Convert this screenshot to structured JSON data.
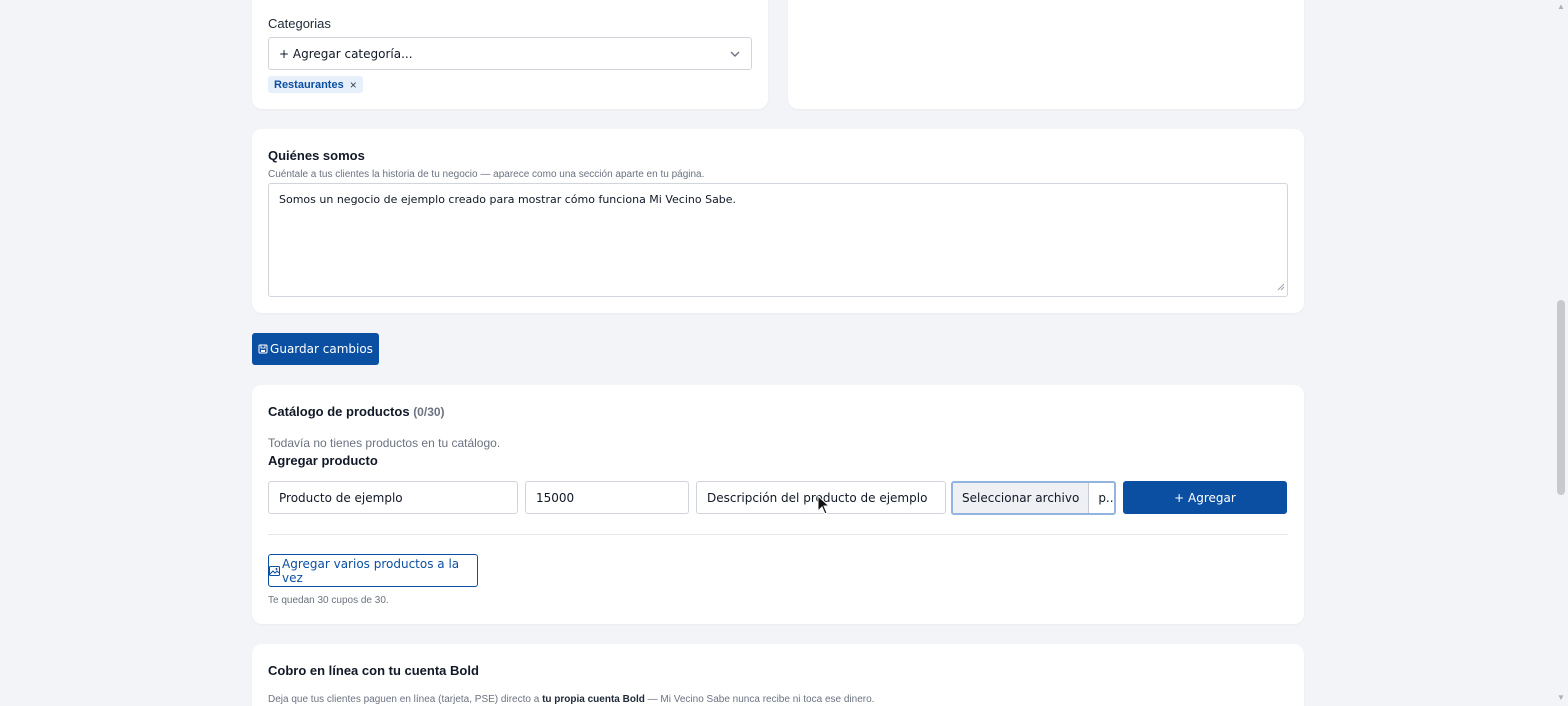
{
  "categories": {
    "label": "Categorias",
    "select_value": "+ Agregar categoría...",
    "tags": [
      {
        "label": "Restaurantes",
        "remove": "×"
      }
    ]
  },
  "about": {
    "title": "Quiénes somos",
    "help": "Cuéntale a tus clientes la historia de tu negocio — aparece como una sección aparte en tu página.",
    "text": "Somos un negocio de ejemplo creado para mostrar cómo funciona Mi Vecino Sabe."
  },
  "save_button": {
    "label": "Guardar cambios",
    "icon": "save-icon"
  },
  "catalog": {
    "title": "Catálogo de productos",
    "count": "(0/30)",
    "empty": "Todavía no tienes productos en tu catálogo.",
    "add_title": "Agregar producto",
    "product_name": "Producto de ejemplo",
    "product_price": "15000",
    "product_description": "Descripción del producto de ejemplo",
    "file_button": "Seleccionar archivo",
    "file_name": "p...",
    "add_button": "+ Agregar",
    "bulk_button": "Agregar varios productos a la vez",
    "remaining": "Te quedan 30 cupos de 30."
  },
  "payments": {
    "title": "Cobro en línea con tu cuenta Bold",
    "desc_before": "Deja que tus clientes paguen en línea (tarjeta, PSE) directo a ",
    "desc_bold": "tu propia cuenta Bold",
    "desc_after": " — Mi Vecino Sabe nunca recibe ni toca ese dinero."
  },
  "colors": {
    "primary": "#0b4fa3",
    "tag_bg": "#e6effa",
    "tag_text": "#0b4fa3"
  }
}
